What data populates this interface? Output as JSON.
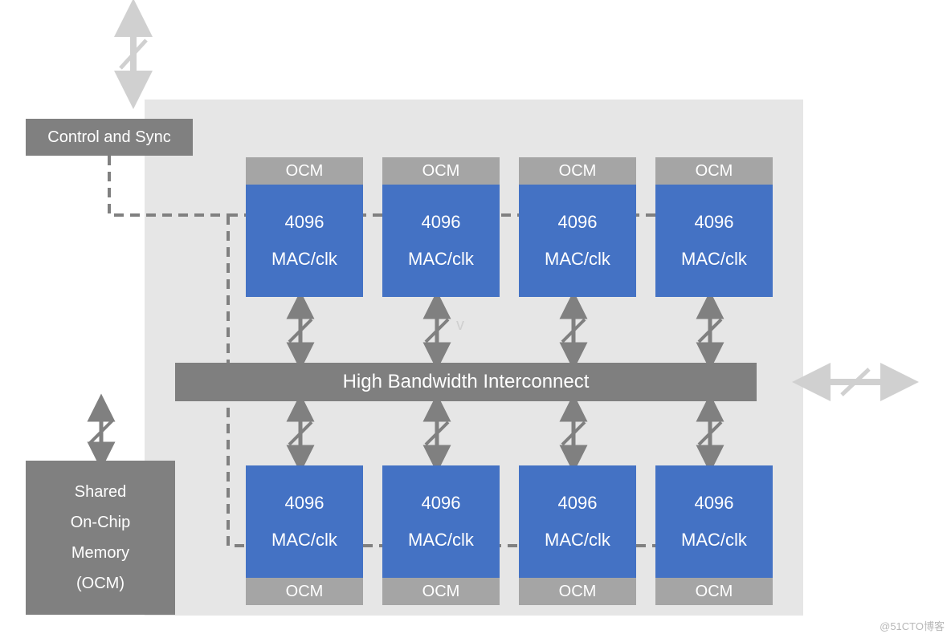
{
  "control_sync": "Control and Sync",
  "shared_ocm": {
    "l1": "Shared",
    "l2": "On-Chip",
    "l3": "Memory",
    "l4": "(OCM)"
  },
  "interconnect": "High Bandwidth Interconnect",
  "ocm_label": "OCM",
  "mac_count": "4096",
  "mac_unit": "MAC/clk",
  "v_label": "v",
  "watermark": "@51CTO博客",
  "colors": {
    "chip_bg": "#e6e6e6",
    "block_gray": "#808080",
    "ocm_gray": "#a5a5a5",
    "mac_blue": "#4472c4"
  }
}
